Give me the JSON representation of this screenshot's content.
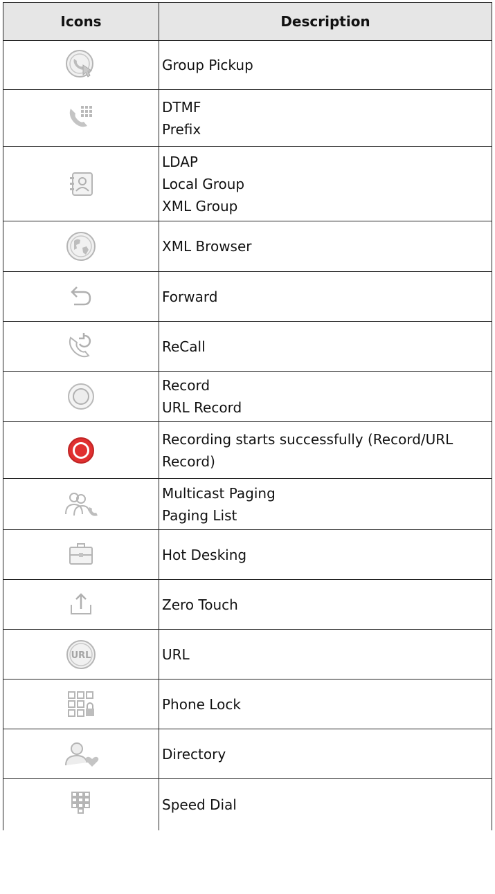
{
  "headers": {
    "icons": "Icons",
    "description": "Description"
  },
  "rows": [
    {
      "icon": "group-pickup-icon",
      "lines": [
        "Group Pickup"
      ]
    },
    {
      "icon": "dtmf-icon",
      "lines": [
        "DTMF",
        "Prefix"
      ]
    },
    {
      "icon": "contact-book-icon",
      "lines": [
        "LDAP",
        "Local Group",
        "XML Group"
      ]
    },
    {
      "icon": "globe-icon",
      "lines": [
        "XML Browser"
      ]
    },
    {
      "icon": "forward-icon",
      "lines": [
        "Forward"
      ]
    },
    {
      "icon": "recall-icon",
      "lines": [
        "ReCall"
      ]
    },
    {
      "icon": "record-icon",
      "lines": [
        "Record",
        "URL Record"
      ]
    },
    {
      "icon": "recording-active-icon",
      "lines": [
        "Recording starts successfully (Record/URL Record)"
      ]
    },
    {
      "icon": "paging-icon",
      "lines": [
        "Multicast Paging",
        "Paging List"
      ]
    },
    {
      "icon": "hot-desking-icon",
      "lines": [
        "Hot Desking"
      ]
    },
    {
      "icon": "zero-touch-icon",
      "lines": [
        "Zero Touch"
      ]
    },
    {
      "icon": "url-icon",
      "lines": [
        "URL"
      ]
    },
    {
      "icon": "phone-lock-icon",
      "lines": [
        "Phone Lock"
      ]
    },
    {
      "icon": "directory-icon",
      "lines": [
        "Directory"
      ]
    },
    {
      "icon": "speed-dial-icon",
      "lines": [
        "Speed Dial"
      ]
    }
  ],
  "colors": {
    "icon_gray": "#b5b5b5",
    "record_red": "#e03030",
    "header_bg": "#e6e6e6"
  }
}
